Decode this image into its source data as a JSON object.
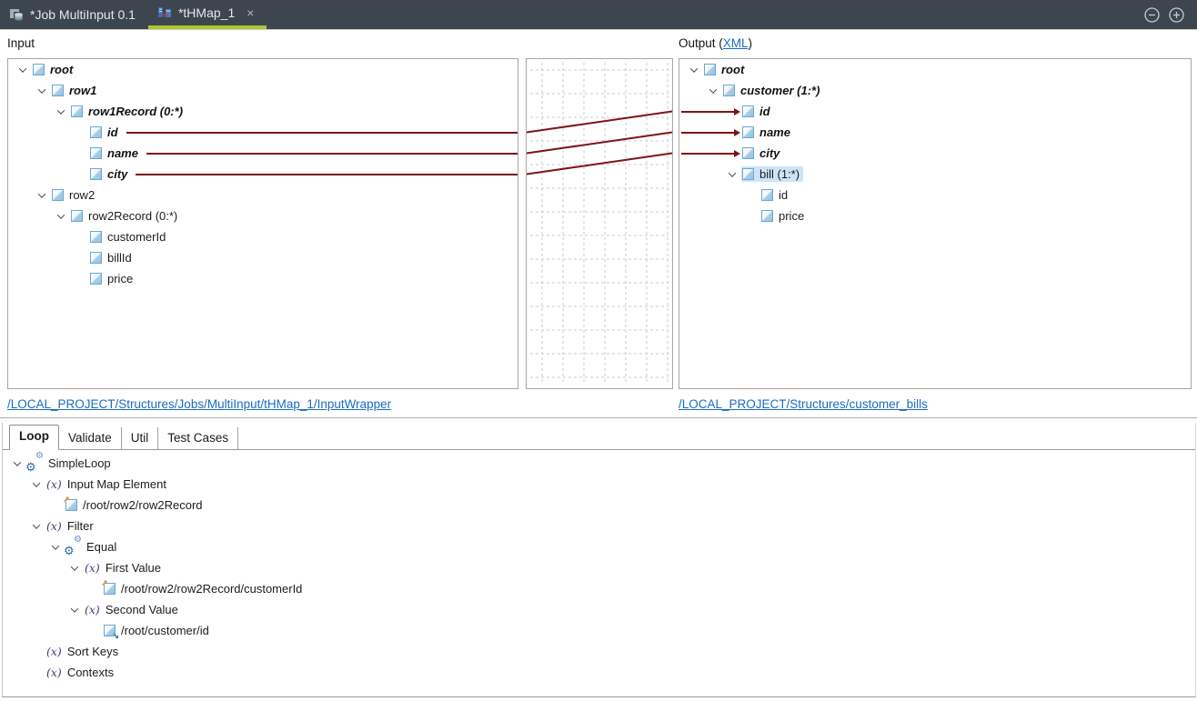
{
  "window": {
    "tabs": [
      {
        "label": "*Job MultiInput 0.1",
        "icon": "job-icon",
        "active": false
      },
      {
        "label": "*tHMap_1",
        "icon": "thmap-icon",
        "active": true,
        "close": "×"
      }
    ],
    "controls": {
      "minimize": "minus-circle",
      "maximize": "plus-circle"
    }
  },
  "mapper": {
    "input_header": "Input",
    "output_header_prefix": "Output (",
    "output_header_link": "XML",
    "output_header_suffix": ")",
    "input_path_link": "/LOCAL_PROJECT/Structures/Jobs/MultiInput/tHMap_1/InputWrapper",
    "output_path_link": "/LOCAL_PROJECT/Structures/customer_bills",
    "input_tree": [
      {
        "label": "root",
        "level": 0,
        "chevron": true,
        "mapped": true
      },
      {
        "label": "row1",
        "level": 1,
        "chevron": true,
        "mapped": true
      },
      {
        "label": "row1Record (0:*)",
        "level": 2,
        "chevron": true,
        "mapped": true
      },
      {
        "label": "id",
        "level": 3,
        "chevron": false,
        "mapped": true,
        "line": true
      },
      {
        "label": "name",
        "level": 3,
        "chevron": false,
        "mapped": true,
        "line": true
      },
      {
        "label": "city",
        "level": 3,
        "chevron": false,
        "mapped": true,
        "line": true
      },
      {
        "label": "row2",
        "level": 1,
        "chevron": true,
        "mapped": false
      },
      {
        "label": "row2Record (0:*)",
        "level": 2,
        "chevron": true,
        "mapped": false
      },
      {
        "label": "customerId",
        "level": 3,
        "chevron": false,
        "mapped": false
      },
      {
        "label": "billId",
        "level": 3,
        "chevron": false,
        "mapped": false
      },
      {
        "label": "price",
        "level": 3,
        "chevron": false,
        "mapped": false
      }
    ],
    "output_tree": [
      {
        "label": "root",
        "level": 0,
        "chevron": true,
        "mapped": true
      },
      {
        "label": "customer (1:*)",
        "level": 1,
        "chevron": true,
        "mapped": true
      },
      {
        "label": "id",
        "level": 2,
        "chevron": false,
        "mapped": true,
        "arrow": true
      },
      {
        "label": "name",
        "level": 2,
        "chevron": false,
        "mapped": true,
        "arrow": true
      },
      {
        "label": "city",
        "level": 2,
        "chevron": false,
        "mapped": true,
        "arrow": true
      },
      {
        "label": "bill (1:*)",
        "level": 2,
        "chevron": true,
        "mapped": false,
        "selected": true
      },
      {
        "label": "id",
        "level": 3,
        "chevron": false,
        "mapped": false
      },
      {
        "label": "price",
        "level": 3,
        "chevron": false,
        "mapped": false
      }
    ],
    "connections": [
      {
        "from_input_row": 3,
        "to_output_row": 2
      },
      {
        "from_input_row": 4,
        "to_output_row": 3
      },
      {
        "from_input_row": 5,
        "to_output_row": 4
      }
    ]
  },
  "bottom": {
    "tabs": [
      "Loop",
      "Validate",
      "Util",
      "Test Cases"
    ],
    "active_tab": "Loop",
    "tree": [
      {
        "label": "SimpleLoop",
        "level": 0,
        "icon": "gears",
        "chevron": true
      },
      {
        "label": "Input Map Element",
        "level": 1,
        "icon": "fx",
        "chevron": true
      },
      {
        "label": "/root/row2/row2Record",
        "level": 2,
        "icon": "element-in",
        "chevron": false
      },
      {
        "label": "Filter",
        "level": 1,
        "icon": "fx",
        "chevron": true
      },
      {
        "label": "Equal",
        "level": 2,
        "icon": "gears",
        "chevron": true
      },
      {
        "label": "First Value",
        "level": 3,
        "icon": "fx",
        "chevron": true
      },
      {
        "label": "/root/row2/row2Record/customerId",
        "level": 4,
        "icon": "element-in",
        "chevron": false
      },
      {
        "label": "Second Value",
        "level": 3,
        "icon": "fx",
        "chevron": true
      },
      {
        "label": "/root/customer/id",
        "level": 4,
        "icon": "element-out",
        "chevron": false
      },
      {
        "label": "Sort Keys",
        "level": 1,
        "icon": "fx",
        "chevron": false
      },
      {
        "label": "Contexts",
        "level": 1,
        "icon": "fx",
        "chevron": false
      }
    ]
  },
  "icons": {
    "fx_glyph": "(x)",
    "gear_glyph": "⚙",
    "dec_up": "↗",
    "dec_down": "↘"
  },
  "colors": {
    "topbar_bg": "#3d464f",
    "tab_underline": "#aec52e",
    "map_line": "#7d1517",
    "link": "#1a6cc0",
    "selection_bg": "#cce4f7",
    "panel_border": "#a6a6a6",
    "grid": "#cccccc"
  }
}
